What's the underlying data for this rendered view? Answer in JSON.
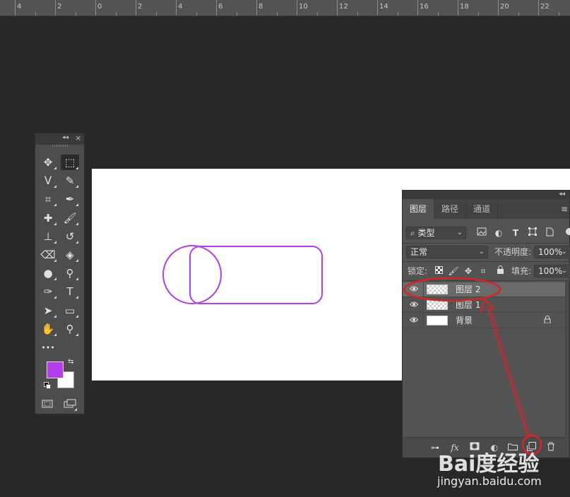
{
  "ruler": {
    "labels": [
      "4",
      "2",
      "0",
      "2",
      "4",
      "6",
      "8",
      "10",
      "12",
      "14",
      "16",
      "18",
      "20",
      "22"
    ]
  },
  "toolbox": {
    "collapse_icon": "collapse-arrows-icon",
    "close_icon": "close-icon",
    "tools": [
      {
        "name": "move-tool",
        "glyph": "✥"
      },
      {
        "name": "rect-marquee-tool",
        "glyph": "⬚",
        "selected": true
      },
      {
        "name": "lasso-tool",
        "glyph": "ᐯ"
      },
      {
        "name": "quick-select-tool",
        "glyph": "✎"
      },
      {
        "name": "crop-tool",
        "glyph": "⌗"
      },
      {
        "name": "eyedropper-tool",
        "glyph": "✒"
      },
      {
        "name": "healing-brush-tool",
        "glyph": "✚"
      },
      {
        "name": "brush-tool",
        "glyph": "🖌"
      },
      {
        "name": "clone-stamp-tool",
        "glyph": "⊥"
      },
      {
        "name": "history-brush-tool",
        "glyph": "↺"
      },
      {
        "name": "eraser-tool",
        "glyph": "⌫"
      },
      {
        "name": "paint-bucket-tool",
        "glyph": "◈"
      },
      {
        "name": "blur-tool",
        "glyph": "●"
      },
      {
        "name": "dodge-tool",
        "glyph": "⚲"
      },
      {
        "name": "pen-tool",
        "glyph": "✑"
      },
      {
        "name": "type-tool",
        "glyph": "T"
      },
      {
        "name": "path-select-tool",
        "glyph": "➤"
      },
      {
        "name": "rectangle-tool",
        "glyph": "▭"
      },
      {
        "name": "hand-tool",
        "glyph": "✋"
      },
      {
        "name": "zoom-tool",
        "glyph": "⚲"
      },
      {
        "name": "more-tools",
        "glyph": "•••"
      }
    ],
    "foreground_color": "#b23fea",
    "background_color": "#ffffff",
    "swap_glyph": "⇆"
  },
  "layers_panel": {
    "tabs": [
      {
        "label": "图层",
        "active": true
      },
      {
        "label": "路径",
        "active": false
      },
      {
        "label": "通道",
        "active": false
      }
    ],
    "filter_kind": "类型",
    "blend_mode": "正常",
    "opacity_label": "不透明度:",
    "opacity_value": "100%",
    "lock_label": "锁定:",
    "fill_label": "填充:",
    "fill_value": "100%",
    "layers": [
      {
        "name": "图层 2",
        "thumb": "transparent",
        "selected": true,
        "locked": false
      },
      {
        "name": "图层 1",
        "thumb": "transparent",
        "selected": false,
        "locked": false
      },
      {
        "name": "背景",
        "thumb": "white",
        "selected": false,
        "locked": true
      }
    ],
    "footer_fx": "fx"
  },
  "canvas": {
    "shape_color": "#b23fea"
  },
  "annotation_color": "#d8232a",
  "watermark": {
    "logo": "Bai度经验",
    "url": "jingyan.baidu.com"
  }
}
